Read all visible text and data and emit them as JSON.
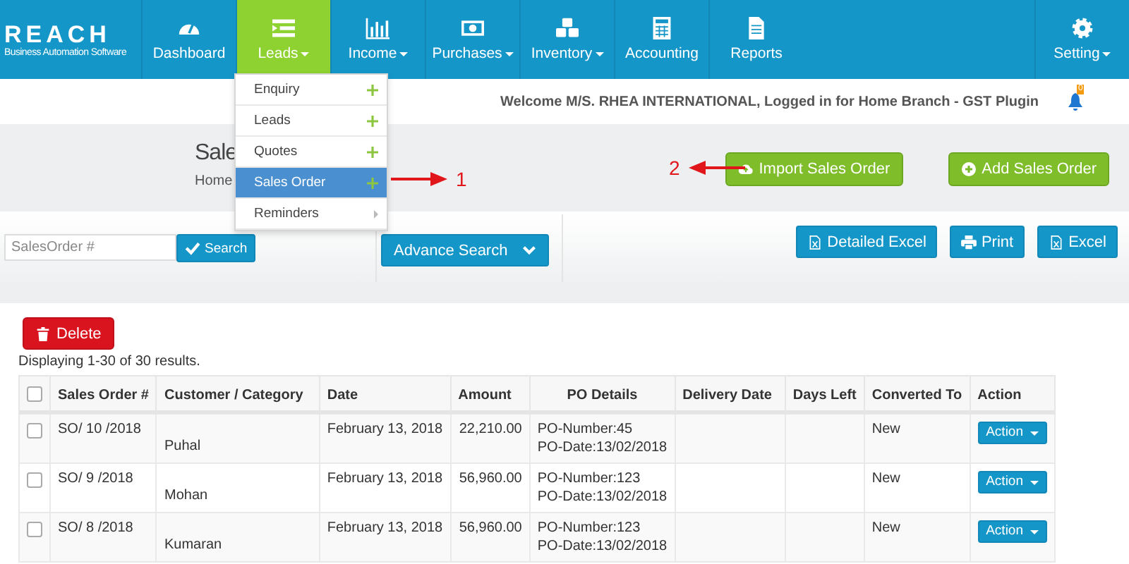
{
  "logo": {
    "name": "REACH",
    "tagline": "Business Automation Software"
  },
  "nav": [
    {
      "label": "Dashboard",
      "kind": "gauge",
      "caret": false,
      "selected": false
    },
    {
      "label": "Leads",
      "kind": "list",
      "caret": true,
      "selected": true
    },
    {
      "label": "Income",
      "kind": "bars",
      "caret": true,
      "selected": false
    },
    {
      "label": "Purchases",
      "kind": "money",
      "caret": true,
      "selected": false
    },
    {
      "label": "Inventory",
      "kind": "cubes",
      "caret": true,
      "selected": false
    },
    {
      "label": "Accounting",
      "kind": "calculator",
      "caret": false,
      "selected": false
    },
    {
      "label": "Reports",
      "kind": "document",
      "caret": false,
      "selected": false
    }
  ],
  "setting": {
    "label": "Setting",
    "caret": true
  },
  "welcome": "Welcome M/S. RHEA INTERNATIONAL, Logged in for Home Branch - GST Plugin",
  "notification_count": "0",
  "page": {
    "title": "Sale",
    "breadcrumb": "Home"
  },
  "header_buttons": [
    {
      "label": "Import Sales Order",
      "kind": "upload"
    },
    {
      "label": "Add Sales Order",
      "kind": "add"
    }
  ],
  "dropdown": [
    {
      "label": "Enquiry",
      "kind": "add",
      "selected": false
    },
    {
      "label": "Leads",
      "kind": "add",
      "selected": false
    },
    {
      "label": "Quotes",
      "kind": "add",
      "selected": false
    },
    {
      "label": "Sales Order",
      "kind": "add",
      "selected": true
    },
    {
      "label": "Reminders",
      "kind": "submenu",
      "selected": false
    }
  ],
  "annotations": [
    {
      "label": "1",
      "kind": "right"
    },
    {
      "label": "2",
      "kind": "left"
    }
  ],
  "search": {
    "placeholder": "SalesOrder #",
    "button": "Search",
    "advance": "Advance Search"
  },
  "export_buttons": [
    {
      "label": "Detailed Excel",
      "kind": "excel"
    },
    {
      "label": "Print",
      "kind": "print"
    },
    {
      "label": "Excel",
      "kind": "excel"
    }
  ],
  "delete_button": "Delete",
  "summary": "Displaying 1-30 of 30 results.",
  "table": {
    "header_checked": false,
    "columns": [
      "Sales Order #",
      "Customer / Category",
      "Date",
      "Amount",
      "PO Details",
      "Delivery Date",
      "Days Left",
      "Converted To",
      "Action"
    ],
    "rows": [
      {
        "checked": false,
        "order": "SO/ 10 /2018",
        "customer": "Puhal",
        "date": "February 13, 2018",
        "amount": "22,210.00",
        "po_number": "PO-Number:45",
        "po_date": "PO-Date:13/02/2018",
        "converted": "New",
        "action": "Action"
      },
      {
        "checked": false,
        "order": "SO/ 9 /2018",
        "customer": "Mohan",
        "date": "February 13, 2018",
        "amount": "56,960.00",
        "po_number": "PO-Number:123",
        "po_date": "PO-Date:13/02/2018",
        "converted": "New",
        "action": "Action"
      },
      {
        "checked": false,
        "order": "SO/ 8 /2018",
        "customer": "Kumaran",
        "date": "February 13, 2018",
        "amount": "56,960.00",
        "po_number": "PO-Number:123",
        "po_date": "PO-Date:13/02/2018",
        "converted": "New",
        "action": "Action"
      }
    ]
  }
}
